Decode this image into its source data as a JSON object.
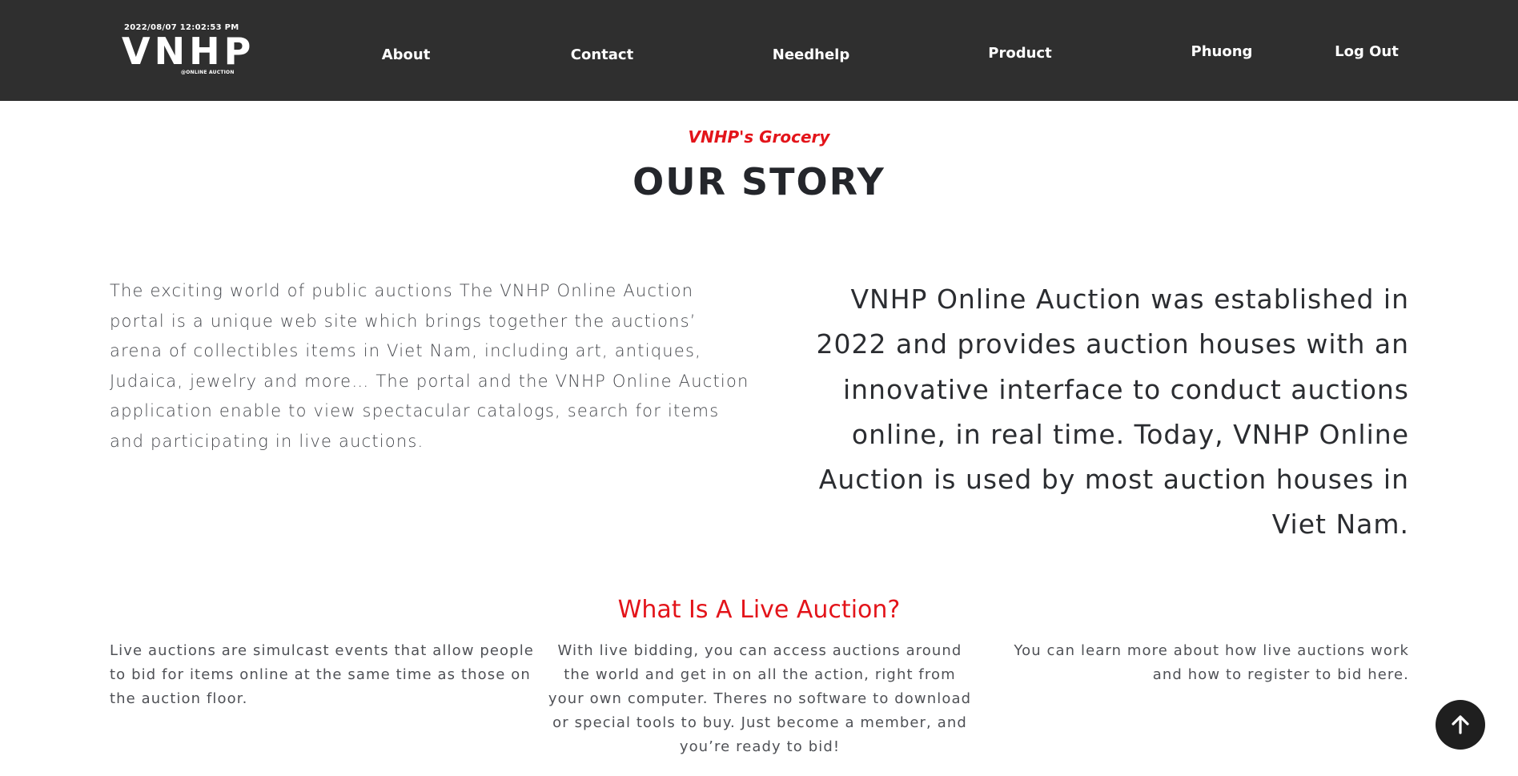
{
  "header": {
    "clock": "2022/08/07 12:02:53 PM",
    "logo": "VNHP",
    "logo_tag": "@ONLINE AUCTION",
    "nav": {
      "about": "About",
      "contact": "Contact",
      "needhelp": "Needhelp",
      "product": "Product",
      "user": "Phuong",
      "logout": "Log Out"
    }
  },
  "story": {
    "subtitle": "VNHP's Grocery",
    "title": "OUR STORY",
    "left_text": "The exciting world of public auctions The VNHP Online Auction portal is a unique web site which brings together the auctions’ arena of collectibles items in Viet Nam, including art, antiques, Judaica, jewelry and more… The portal and the VNHP Online Auction application enable to view spectacular catalogs, search for items and participating in live auctions.",
    "right_text": "VNHP Online Auction was established in 2022 and provides auction houses with an innovative interface to conduct auctions online, in real time. Today, VNHP Online Auction is used by most auction houses in Viet Nam."
  },
  "live_auction": {
    "title": "What Is A Live Auction?",
    "col1": "Live auctions are simulcast events that allow people to bid for items online at the same time as those on the auction floor.",
    "col2": "With live bidding, you can access auctions around the world and get in on all the action, right from your own computer. Theres no software to download or special tools to buy. Just become a member, and you’re ready to bid!",
    "col3": "You can learn more about how live auctions work and how to register to bid here."
  },
  "back_to_top": {
    "icon": "arrow-up-icon"
  },
  "colors": {
    "navbar_bg": "#2f2f2f",
    "accent_red": "#e3141a",
    "heading": "#24262b"
  }
}
